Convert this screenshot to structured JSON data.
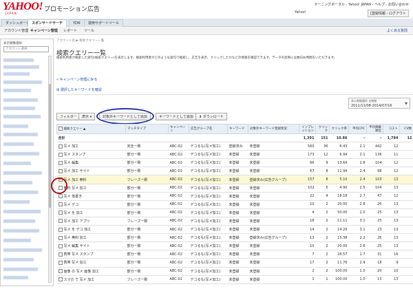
{
  "header": {
    "logo_text": "YAHOO!",
    "logo_sub": "JAPAN",
    "product_title": "プロモーション広告",
    "top_links": "ラーニングポータル - Yahoo! JAPAN - ヘルプ - お問い合わせ",
    "yahoo_id_label": "Yahoo!",
    "account_button": "[登録情報 - ログアウト"
  },
  "tabs": [
    "ダッシュボード",
    "スポンサードサーチ",
    "YDN",
    "運用サポートツール"
  ],
  "subnav": {
    "items": [
      "アカウント管理",
      "キャンペーン管理",
      "レポート",
      "ツール"
    ],
    "help": "よくある質問"
  },
  "sidebar": {
    "label": "表示順番選択",
    "select_placeholder": "アカウント選択"
  },
  "breadcrumb": "アカウント名 ▶ 検索クエリー一覧",
  "page_title": "検索クエリー一覧",
  "description": "検索利用者が検索した語句(検索クエリー)を表示します。検索利用者がどのような語句で検索し、広告を表示、クリックしたかなどの情報を確認できます。データの反映には数日お時間をいただきます。",
  "links": {
    "back": "« キャンペーン管理に戻る",
    "check": "⊞ 選択したキーワードを確認"
  },
  "period": {
    "label": "表示期間選択 全期間",
    "value": "2011/11/08-2014/07/16",
    "arrow": "▼"
  },
  "toolbar": {
    "filter": "フィルター",
    "display": "表示 ▾",
    "add_exclude": "対象外キーワードとして追加",
    "add_keyword": "キーワードとして追加",
    "download": "⬇ ダウンロード"
  },
  "table": {
    "headers": [
      "検索クエリー ▲",
      "マッチタイプ",
      "キャンペーン",
      "広告グループ名",
      "キーワード",
      "対象外キーワード登録状況",
      "インプレッション",
      "クリック",
      "クリック率",
      "平均CPC",
      "平均掲載順位",
      "コスト",
      "CV数"
    ],
    "total": {
      "label": "合計",
      "imp": "1,391",
      "clk": "151",
      "ctr": "10.86",
      "cpc": "–",
      "pos": "–",
      "cost": "1,784",
      "cv": "12"
    },
    "rows": [
      {
        "q": "写メ 加工",
        "m": "完全一致",
        "c": "ABC-02",
        "g": "デコるも(写メ加工)",
        "k": "登録済み",
        "e": "未登録",
        "imp": "560",
        "clk": "36",
        "ctr": "6.43",
        "cpc": "2.1",
        "pos": "442",
        "cost": "12",
        "cv": "",
        "checked": false
      },
      {
        "q": "写メ スタンプ",
        "m": "部分一致",
        "c": "ABC-02",
        "g": "デコるも(写メ加工)",
        "k": "未登録",
        "e": "未登録",
        "imp": "173",
        "clk": "12",
        "ctr": "6.94",
        "cpc": "2.1",
        "pos": "136",
        "cost": "11",
        "cv": "",
        "checked": false
      },
      {
        "q": "写メ 編集",
        "m": "部分一致",
        "c": "ABC-02",
        "g": "デコるも(写メ加工)",
        "k": "未登録",
        "e": "未登録",
        "imp": "66",
        "clk": "9",
        "ctr": "13.64",
        "cpc": "1.8",
        "pos": "104",
        "cost": "12",
        "cv": "",
        "checked": false
      },
      {
        "q": "写メ 加工 サイト",
        "m": "部分一致",
        "c": "ABC-02",
        "g": "デコるも(写メ加工)",
        "k": "未登録",
        "e": "未登録",
        "imp": "67",
        "clk": "8",
        "ctr": "11.94",
        "cpc": "2.4",
        "pos": "98",
        "cost": "12",
        "cv": "",
        "checked": false
      },
      {
        "q": "写メ 加工 無料",
        "m": "フレーズ一致",
        "c": "ABC-02",
        "g": "デコるも(写メ加工)",
        "k": "未登録",
        "e": "登録済み(広告グループ)",
        "imp": "157",
        "clk": "8",
        "ctr": "5.10",
        "cpc": "2.4",
        "pos": "103",
        "cost": "13",
        "cv": "",
        "checked": true,
        "hl": true
      },
      {
        "q": "無料 写メ 加工",
        "m": "部分一致",
        "c": "ABC-02",
        "g": "デコるも(写メ加工)",
        "k": "未登録",
        "e": "未登録",
        "imp": "102",
        "clk": "5",
        "ctr": "4.90",
        "cpc": "2.5",
        "pos": "104",
        "cost": "13",
        "cv": "",
        "checked": false
      },
      {
        "q": "写メ 落書き",
        "m": "部分一致",
        "c": "ABC-02",
        "g": "デコるも(写メ加工)",
        "k": "未登録",
        "e": "未登録",
        "imp": "22",
        "clk": "4",
        "ctr": "18.18",
        "cpc": "2.7",
        "pos": "47",
        "cost": "12",
        "cv": "",
        "checked": false
      },
      {
        "q": "写メ デコ",
        "m": "部分一致",
        "c": "ABC-02",
        "g": "デコるも(写メ加工)",
        "k": "未登録",
        "e": "未登録",
        "imp": "10",
        "clk": "2",
        "ctr": "20.00",
        "cpc": "2.8",
        "pos": "26",
        "cost": "13",
        "cv": "",
        "checked": false
      },
      {
        "q": "写メ を 加工",
        "m": "部分一致",
        "c": "ABC-02",
        "g": "デコるも(写メ加工)",
        "k": "未登録",
        "e": "未登録",
        "imp": "4",
        "clk": "2",
        "ctr": "50.00",
        "cpc": "2.0",
        "pos": "25",
        "cost": "13",
        "cv": "",
        "checked": false
      },
      {
        "q": "写メ 加工 アプリ",
        "m": "フレーズ一致",
        "c": "ABC-02",
        "g": "デコるも(写メ加工)",
        "k": "未登録",
        "e": "未登録",
        "imp": "18",
        "clk": "2",
        "ctr": "11.11",
        "cpc": "3.1",
        "pos": "25",
        "cost": "13",
        "cv": "",
        "checked": false
      },
      {
        "q": "写メ を デコ 加工",
        "m": "部分一致",
        "c": "ABC-02",
        "g": "デコるも(写メ加工)",
        "k": "未登録",
        "e": "未登録",
        "imp": "14",
        "clk": "2",
        "ctr": "14.29",
        "cpc": "3.1",
        "pos": "23",
        "cost": "13",
        "cv": "",
        "checked": false
      },
      {
        "q": "写メ 無料 加工",
        "m": "部分一致",
        "c": "ABC-02",
        "g": "デコるも(写メ加工)",
        "k": "未登録",
        "e": "登録済み(広告グループ)",
        "imp": "13",
        "clk": "2",
        "ctr": "15.38",
        "cpc": "2.2",
        "pos": "26",
        "cost": "13",
        "cv": "",
        "checked": false
      },
      {
        "q": "写メ 編集 サイト",
        "m": "部分一致",
        "c": "ABC-02",
        "g": "デコるも(写メ加工)",
        "k": "未登録",
        "e": "未登録",
        "imp": "10",
        "clk": "2",
        "ctr": "20.00",
        "cpc": "2.6",
        "pos": "25",
        "cost": "13",
        "cv": "",
        "checked": false
      },
      {
        "q": "携帯 写メ スタンプ",
        "m": "部分一致",
        "c": "ABC-02",
        "g": "デコるも(写メ加工)",
        "k": "未登録",
        "e": "未登録",
        "imp": "7",
        "clk": "2",
        "ctr": "28.57",
        "cpc": "1.7",
        "pos": "31",
        "cost": "16",
        "cv": "",
        "checked": false
      },
      {
        "q": "携帯 写メ 加工",
        "m": "部分一致",
        "c": "ABC-02",
        "g": "デコるも(写メ加工)",
        "k": "未登録",
        "e": "未登録",
        "imp": "17",
        "clk": "2",
        "ctr": "11.76",
        "cpc": "2.9",
        "pos": "18",
        "cost": "9",
        "cv": "",
        "checked": false
      },
      {
        "q": "画像 の 写メ 画像 加工",
        "m": "部分一致",
        "c": "ABC-02",
        "g": "デコるも(写メ加工)",
        "k": "未登録",
        "e": "未登録",
        "imp": "2",
        "clk": "2",
        "ctr": "100.00",
        "cpc": "1.0",
        "pos": "20",
        "cost": "10",
        "cv": "",
        "checked": false
      },
      {
        "q": "スマホ で 写メ 加工",
        "m": "フレーズ一致",
        "c": "ABC-02",
        "g": "デコるも(写メ加工)",
        "k": "未登録",
        "e": "未登録",
        "imp": "1",
        "clk": "1",
        "ctr": "100.00",
        "cpc": "1.0",
        "pos": "13",
        "cost": "13",
        "cv": "",
        "checked": false
      }
    ]
  }
}
